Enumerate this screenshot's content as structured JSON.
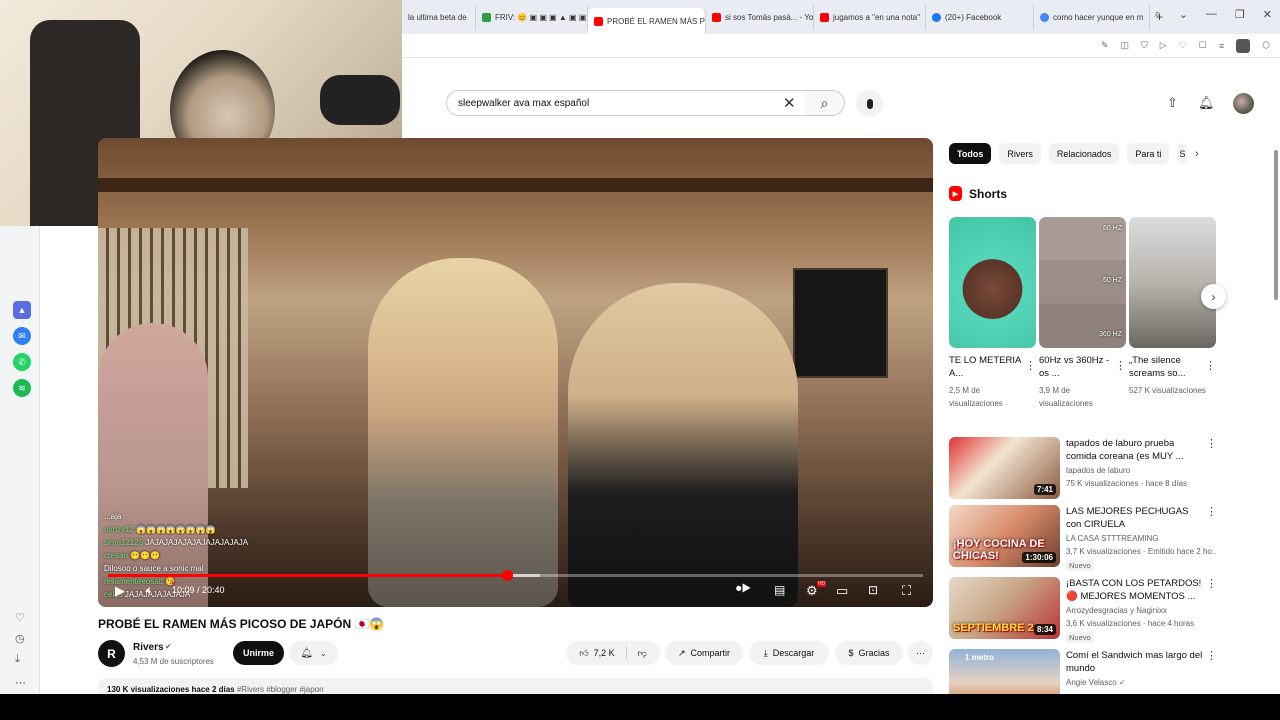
{
  "browser": {
    "tabs": [
      {
        "label": "la ultima beta de",
        "color": "#2d6cdf"
      },
      {
        "label": "FRIV: 😊 ▣ ▣ ▣ ▲ ▣ ▣ ▣",
        "color": "#2ea043"
      },
      {
        "label": "PROBÉ EL RAMEN MÁS PI",
        "color": "#ff0000"
      },
      {
        "label": "si sos Tomás pasá... - You",
        "color": "#ff0000"
      },
      {
        "label": "jugamos a \"en una nota\"",
        "color": "#ff0000"
      },
      {
        "label": "(20+) Facebook",
        "color": "#1877f2"
      },
      {
        "label": "como hacer yunque en m",
        "color": "#4285f4"
      }
    ],
    "new_tab": "+",
    "window_controls": [
      "⌕",
      "⌄",
      "—",
      "❐",
      "✕"
    ]
  },
  "search": {
    "query": "sleepwalker ava max español",
    "clear_icon": "✕",
    "search_icon": "⌕",
    "mic_icon": "🎙"
  },
  "player": {
    "chat": [
      {
        "user": "",
        "msg": "...aja"
      },
      {
        "user": "nimzy12",
        "msg": "😱😱😱😱😱😱😱😱"
      },
      {
        "user": "sime12123",
        "msg": "JAJAJAJAJAJAJAJAJAJAJA"
      },
      {
        "user": "cresan",
        "msg": "😶😶😶"
      },
      {
        "user": "",
        "msg": "Dilosoo o sauce a sonic mal"
      },
      {
        "user": "rellamenteeosatt",
        "msg": "😘"
      },
      {
        "user": "celes",
        "msg": "JAJAJAJAJAJAJA"
      }
    ],
    "time": "10:09 / 20:40",
    "progress_fraction": 0.49,
    "buffered_fraction": 0.53,
    "hd_badge": "HD"
  },
  "video": {
    "title": "PROBÉ EL RAMEN MÁS PICOSO DE JAPÓN 🇯🇵😱",
    "channel": "Rivers",
    "channel_initial": "R",
    "subscribers": "4,53 M de suscriptores",
    "join_label": "Unirme",
    "likes": "7,2 K",
    "share_label": "Compartir",
    "download_label": "Descargar",
    "thanks_label": "Gracias",
    "more": "···",
    "description_meta": "130 K visualizaciones  hace 2 días",
    "description_tags": "#Rivers #blogger #japon"
  },
  "chips": [
    "Todos",
    "Rivers",
    "Relacionados",
    "Para ti",
    "S"
  ],
  "shorts": {
    "heading": "Shorts",
    "items": [
      {
        "title": "TE LO METERIA A...",
        "views": "2,5 M de visualizaciones"
      },
      {
        "title": "60Hz vs 360Hz - os ...",
        "views": "3,9 M de visualizaciones",
        "hz": [
          "60 HZ",
          "60 HZ",
          "360 HZ"
        ]
      },
      {
        "title": "„The silence screams so...",
        "views": "527 K visualizaciones"
      }
    ]
  },
  "recommendations": [
    {
      "title": "tapados de laburo prueba comida coreana (es MUY ...",
      "channel": "tapados de laburo",
      "meta": "75 K visualizaciones · hace 8 días",
      "duration": "7:41",
      "badge": "",
      "thumb_text": ""
    },
    {
      "title": "LAS MEJORES PECHUGAS con CIRUELA",
      "channel": "LA CASA STTTREAMING",
      "meta": "3,7 K visualizaciones · Emitido hace 2 ho...",
      "duration": "1:30:06",
      "badge": "Nuevo",
      "thumb_text": "¡HOY COCINA DE CHICAS!"
    },
    {
      "title": "¡BASTA CON LOS PETARDOS! 🔴 MEJORES MOMENTOS ...",
      "channel": "Arrozydesgracias y Naginixx",
      "meta": "3,6 K visualizaciones · hace 4 horas",
      "duration": "8:34",
      "badge": "Nuevo",
      "thumb_text": "SEPTIEMBRE 2"
    },
    {
      "title": "Comí el Sandwich mas largo del mundo",
      "channel": "Angie Velasco ✓",
      "meta": "",
      "duration": "",
      "badge": "",
      "thumb_text": "1 metro"
    }
  ]
}
